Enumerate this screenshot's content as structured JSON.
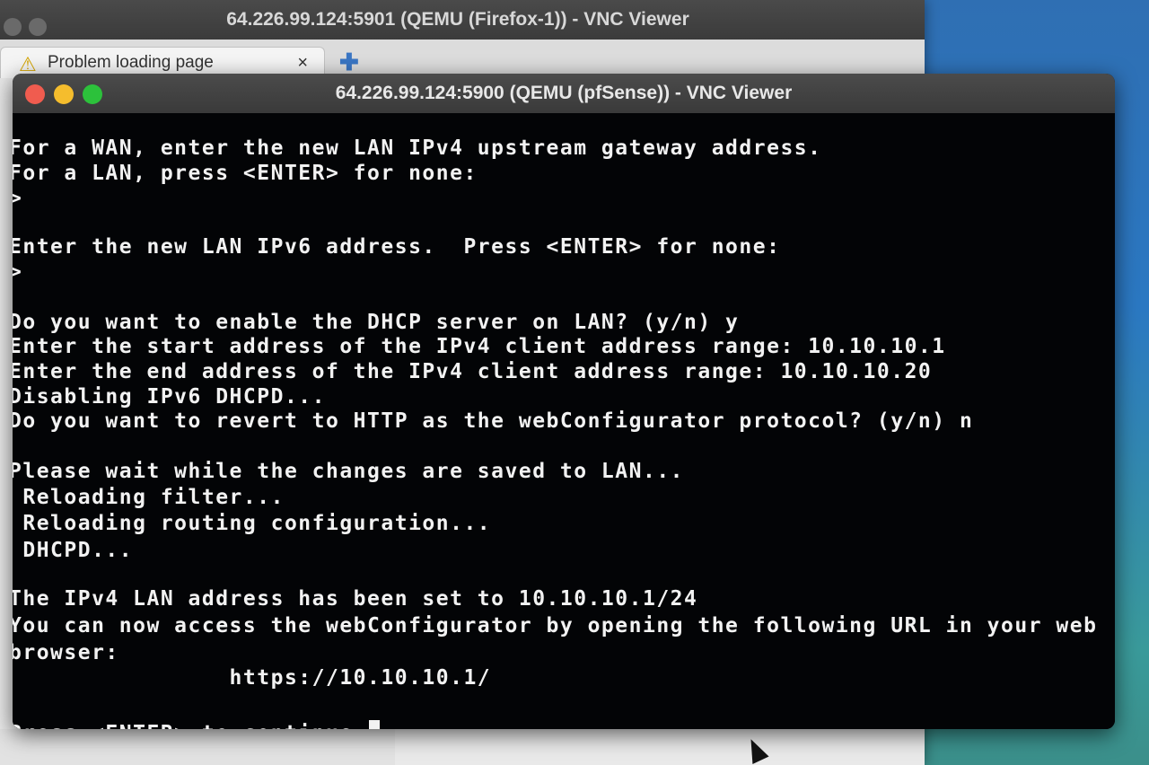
{
  "back_window": {
    "title": "64.226.99.124:5901 (QEMU (Firefox-1)) - VNC Viewer",
    "tab_label": "Problem loading page",
    "tab_close": "×",
    "new_tab": "✚"
  },
  "front_window": {
    "title": "64.226.99.124:5900 (QEMU (pfSense)) - VNC Viewer"
  },
  "terminal": {
    "lines": [
      "For a WAN, enter the new LAN IPv4 upstream gateway address.",
      "For a LAN, press <ENTER> for none:",
      ">",
      "",
      "Enter the new LAN IPv6 address.  Press <ENTER> for none:",
      ">",
      "",
      "Do you want to enable the DHCP server on LAN? (y/n) y",
      "Enter the start address of the IPv4 client address range: 10.10.10.1",
      "Enter the end address of the IPv4 client address range: 10.10.10.20",
      "Disabling IPv6 DHCPD...",
      "Do you want to revert to HTTP as the webConfigurator protocol? (y/n) n",
      "",
      "Please wait while the changes are saved to LAN...",
      " Reloading filter...",
      " Reloading routing configuration...",
      " DHCPD...",
      "",
      "The IPv4 LAN address has been set to 10.10.10.1/24",
      "You can now access the webConfigurator by opening the following URL in your web",
      "browser:",
      "                https://10.10.10.1/",
      "",
      "Press <ENTER> to continue."
    ]
  }
}
